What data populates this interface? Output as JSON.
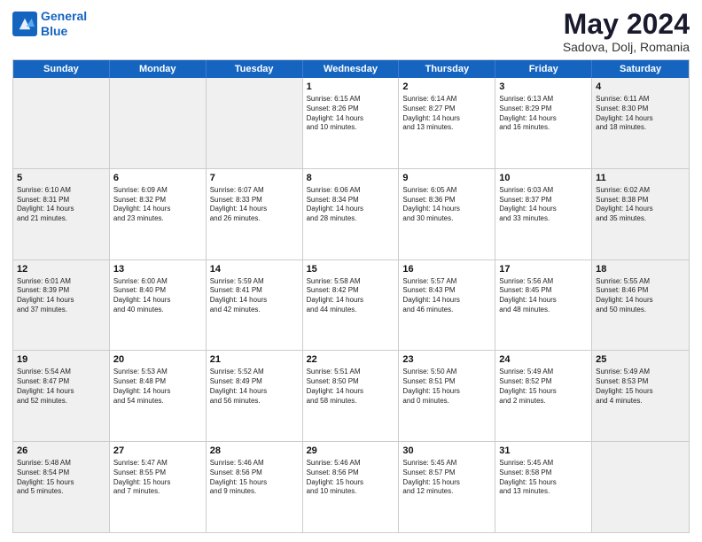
{
  "header": {
    "logo_line1": "General",
    "logo_line2": "Blue",
    "month": "May 2024",
    "location": "Sadova, Dolj, Romania"
  },
  "weekdays": [
    "Sunday",
    "Monday",
    "Tuesday",
    "Wednesday",
    "Thursday",
    "Friday",
    "Saturday"
  ],
  "rows": [
    [
      {
        "day": "",
        "info": "",
        "shaded": true
      },
      {
        "day": "",
        "info": "",
        "shaded": true
      },
      {
        "day": "",
        "info": "",
        "shaded": true
      },
      {
        "day": "1",
        "info": "Sunrise: 6:15 AM\nSunset: 8:26 PM\nDaylight: 14 hours\nand 10 minutes.",
        "shaded": false
      },
      {
        "day": "2",
        "info": "Sunrise: 6:14 AM\nSunset: 8:27 PM\nDaylight: 14 hours\nand 13 minutes.",
        "shaded": false
      },
      {
        "day": "3",
        "info": "Sunrise: 6:13 AM\nSunset: 8:29 PM\nDaylight: 14 hours\nand 16 minutes.",
        "shaded": false
      },
      {
        "day": "4",
        "info": "Sunrise: 6:11 AM\nSunset: 8:30 PM\nDaylight: 14 hours\nand 18 minutes.",
        "shaded": true
      }
    ],
    [
      {
        "day": "5",
        "info": "Sunrise: 6:10 AM\nSunset: 8:31 PM\nDaylight: 14 hours\nand 21 minutes.",
        "shaded": true
      },
      {
        "day": "6",
        "info": "Sunrise: 6:09 AM\nSunset: 8:32 PM\nDaylight: 14 hours\nand 23 minutes.",
        "shaded": false
      },
      {
        "day": "7",
        "info": "Sunrise: 6:07 AM\nSunset: 8:33 PM\nDaylight: 14 hours\nand 26 minutes.",
        "shaded": false
      },
      {
        "day": "8",
        "info": "Sunrise: 6:06 AM\nSunset: 8:34 PM\nDaylight: 14 hours\nand 28 minutes.",
        "shaded": false
      },
      {
        "day": "9",
        "info": "Sunrise: 6:05 AM\nSunset: 8:36 PM\nDaylight: 14 hours\nand 30 minutes.",
        "shaded": false
      },
      {
        "day": "10",
        "info": "Sunrise: 6:03 AM\nSunset: 8:37 PM\nDaylight: 14 hours\nand 33 minutes.",
        "shaded": false
      },
      {
        "day": "11",
        "info": "Sunrise: 6:02 AM\nSunset: 8:38 PM\nDaylight: 14 hours\nand 35 minutes.",
        "shaded": true
      }
    ],
    [
      {
        "day": "12",
        "info": "Sunrise: 6:01 AM\nSunset: 8:39 PM\nDaylight: 14 hours\nand 37 minutes.",
        "shaded": true
      },
      {
        "day": "13",
        "info": "Sunrise: 6:00 AM\nSunset: 8:40 PM\nDaylight: 14 hours\nand 40 minutes.",
        "shaded": false
      },
      {
        "day": "14",
        "info": "Sunrise: 5:59 AM\nSunset: 8:41 PM\nDaylight: 14 hours\nand 42 minutes.",
        "shaded": false
      },
      {
        "day": "15",
        "info": "Sunrise: 5:58 AM\nSunset: 8:42 PM\nDaylight: 14 hours\nand 44 minutes.",
        "shaded": false
      },
      {
        "day": "16",
        "info": "Sunrise: 5:57 AM\nSunset: 8:43 PM\nDaylight: 14 hours\nand 46 minutes.",
        "shaded": false
      },
      {
        "day": "17",
        "info": "Sunrise: 5:56 AM\nSunset: 8:45 PM\nDaylight: 14 hours\nand 48 minutes.",
        "shaded": false
      },
      {
        "day": "18",
        "info": "Sunrise: 5:55 AM\nSunset: 8:46 PM\nDaylight: 14 hours\nand 50 minutes.",
        "shaded": true
      }
    ],
    [
      {
        "day": "19",
        "info": "Sunrise: 5:54 AM\nSunset: 8:47 PM\nDaylight: 14 hours\nand 52 minutes.",
        "shaded": true
      },
      {
        "day": "20",
        "info": "Sunrise: 5:53 AM\nSunset: 8:48 PM\nDaylight: 14 hours\nand 54 minutes.",
        "shaded": false
      },
      {
        "day": "21",
        "info": "Sunrise: 5:52 AM\nSunset: 8:49 PM\nDaylight: 14 hours\nand 56 minutes.",
        "shaded": false
      },
      {
        "day": "22",
        "info": "Sunrise: 5:51 AM\nSunset: 8:50 PM\nDaylight: 14 hours\nand 58 minutes.",
        "shaded": false
      },
      {
        "day": "23",
        "info": "Sunrise: 5:50 AM\nSunset: 8:51 PM\nDaylight: 15 hours\nand 0 minutes.",
        "shaded": false
      },
      {
        "day": "24",
        "info": "Sunrise: 5:49 AM\nSunset: 8:52 PM\nDaylight: 15 hours\nand 2 minutes.",
        "shaded": false
      },
      {
        "day": "25",
        "info": "Sunrise: 5:49 AM\nSunset: 8:53 PM\nDaylight: 15 hours\nand 4 minutes.",
        "shaded": true
      }
    ],
    [
      {
        "day": "26",
        "info": "Sunrise: 5:48 AM\nSunset: 8:54 PM\nDaylight: 15 hours\nand 5 minutes.",
        "shaded": true
      },
      {
        "day": "27",
        "info": "Sunrise: 5:47 AM\nSunset: 8:55 PM\nDaylight: 15 hours\nand 7 minutes.",
        "shaded": false
      },
      {
        "day": "28",
        "info": "Sunrise: 5:46 AM\nSunset: 8:56 PM\nDaylight: 15 hours\nand 9 minutes.",
        "shaded": false
      },
      {
        "day": "29",
        "info": "Sunrise: 5:46 AM\nSunset: 8:56 PM\nDaylight: 15 hours\nand 10 minutes.",
        "shaded": false
      },
      {
        "day": "30",
        "info": "Sunrise: 5:45 AM\nSunset: 8:57 PM\nDaylight: 15 hours\nand 12 minutes.",
        "shaded": false
      },
      {
        "day": "31",
        "info": "Sunrise: 5:45 AM\nSunset: 8:58 PM\nDaylight: 15 hours\nand 13 minutes.",
        "shaded": false
      },
      {
        "day": "",
        "info": "",
        "shaded": true
      }
    ]
  ]
}
